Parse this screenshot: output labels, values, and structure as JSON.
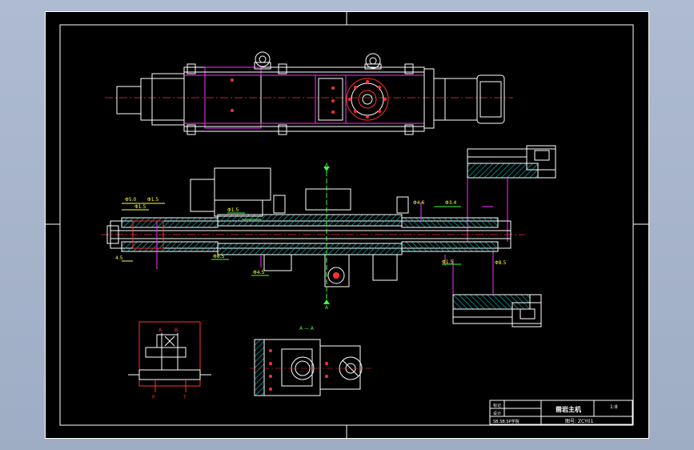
{
  "title_block": {
    "part_name": "凿岩主机",
    "scale": "1:8",
    "drawing_no": "图号: ZCY01",
    "school": "SB.SB.SP学院",
    "row_labels": [
      "标记",
      "设计",
      "审核"
    ]
  },
  "section": {
    "label_a": "A",
    "label_aa": "A — A"
  },
  "hydraulic": {
    "port_a": "A",
    "port_b": "B",
    "port_p": "P",
    "port_t": "T"
  },
  "dimensions": {
    "d1": "Φ5.0",
    "d2": "Φ1.5",
    "d3": "Φ1.5",
    "d4": "Φ1.5",
    "d5": "Φ4.6",
    "d6": "Φ3.4",
    "d7": "Φ8.5",
    "d8": "Φ4.5",
    "d9": "Φ1.5",
    "d10": "4.5",
    "d11": "Φ8.5"
  },
  "colors": {
    "outline": "#ffffff",
    "hatch_cyan": "#00c8c8",
    "magenta": "#ff2cff",
    "red": "#ff3030",
    "yellow": "#ffff40",
    "green": "#40ff40"
  }
}
